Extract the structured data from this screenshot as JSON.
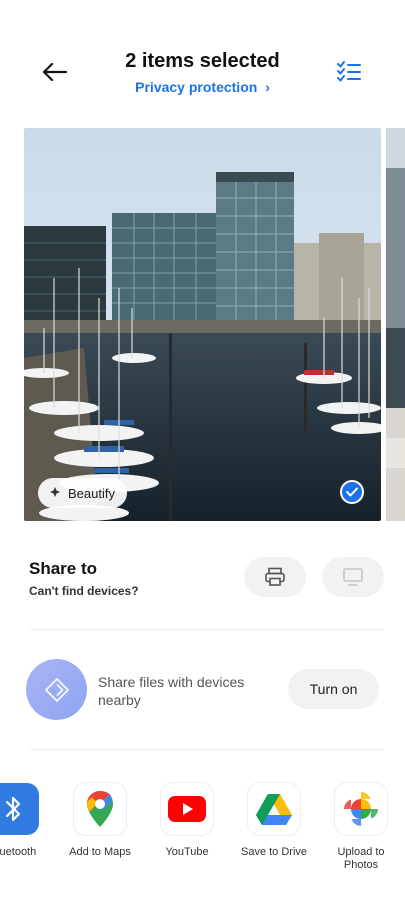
{
  "header": {
    "title": "2 items selected",
    "privacy_link": "Privacy protection",
    "privacy_chevron": "›"
  },
  "photo": {
    "beautify_label": "Beautify",
    "selected": true
  },
  "share_to": {
    "title": "Share to",
    "subtitle": "Can't find devices?",
    "devices": [
      {
        "icon": "printer-icon"
      },
      {
        "icon": "tv-icon"
      }
    ]
  },
  "nearby": {
    "text": "Share files with devices nearby",
    "button_label": "Turn on"
  },
  "apps": [
    {
      "label": "Bluetooth",
      "icon": "bluetooth-icon"
    },
    {
      "label": "Add to Maps",
      "icon": "google-maps-icon"
    },
    {
      "label": "YouTube",
      "icon": "youtube-icon"
    },
    {
      "label": "Save to Drive",
      "icon": "google-drive-icon"
    },
    {
      "label": "Upload to Photos",
      "icon": "google-photos-icon"
    }
  ],
  "colors": {
    "accent": "#1a73e8",
    "button_bg": "#f2f2f2",
    "nearby_icon": "#9aaaf3"
  }
}
